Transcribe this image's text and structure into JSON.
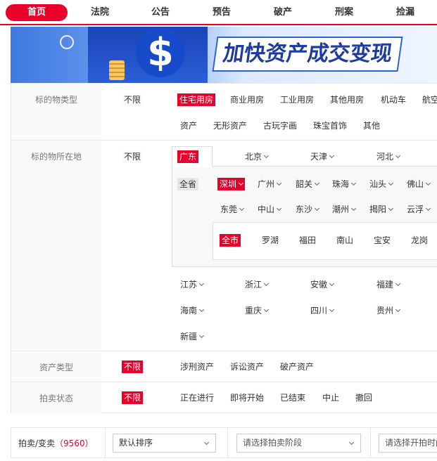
{
  "nav": {
    "items": [
      "首页",
      "法院",
      "公告",
      "预告",
      "破产",
      "刑案",
      "捡漏"
    ]
  },
  "banner": {
    "slogan": "加快资产成交变现"
  },
  "filters": {
    "subject_type": {
      "label": "标的物类型",
      "unlimited": "不限",
      "options_row1": [
        "住宅用房",
        "商业用房",
        "工业用房",
        "其他用房",
        "机动车",
        "航空"
      ],
      "options_row2": [
        "资产",
        "无形资产",
        "古玩字画",
        "珠宝首饰",
        "其他"
      ]
    },
    "location": {
      "label": "标的物所在地",
      "unlimited": "不限",
      "provinces_row1": [
        "广东",
        "北京",
        "天津",
        "河北"
      ],
      "guangdong": {
        "all_province": "全省",
        "cities_row1": [
          "深圳",
          "广州",
          "韶关",
          "珠海",
          "汕头",
          "佛山"
        ],
        "cities_row2": [
          "东莞",
          "中山",
          "东沙",
          "潮州",
          "揭阳",
          "云浮"
        ],
        "shenzhen": {
          "all_city": "全市",
          "districts": [
            "罗湖",
            "福田",
            "南山",
            "宝安",
            "龙岗"
          ]
        }
      },
      "provinces_row2": [
        "江苏",
        "浙江",
        "安徽",
        "福建"
      ],
      "provinces_row3": [
        "海南",
        "重庆",
        "四川",
        "贵州"
      ],
      "provinces_row4": [
        "新疆"
      ]
    },
    "asset_type": {
      "label": "资产类型",
      "unlimited": "不限",
      "options": [
        "涉刑资产",
        "诉讼资产",
        "破产资产"
      ]
    },
    "auction_status": {
      "label": "拍卖状态",
      "unlimited": "不限",
      "options": [
        "正在进行",
        "即将开始",
        "已结束",
        "中止",
        "撤回"
      ]
    }
  },
  "results": {
    "label": "拍卖/变卖",
    "count": "（9560）",
    "sort": "默认排序",
    "stage_placeholder": "请选择拍卖阶段",
    "start_time_placeholder": "请选择开拍时间"
  },
  "colors": {
    "accent": "#e8002a",
    "banner_blue": "#2c62d8"
  }
}
